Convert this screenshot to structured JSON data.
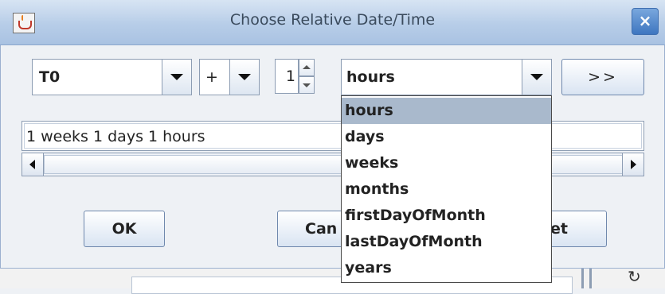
{
  "window": {
    "title": "Choose Relative Date/Time",
    "close_glyph": "×"
  },
  "reference_combo": {
    "value": "T0"
  },
  "operator_combo": {
    "value": "+"
  },
  "amount_spinner": {
    "value": "1"
  },
  "unit_combo": {
    "value": "hours",
    "options": [
      "hours",
      "days",
      "weeks",
      "months",
      "firstDayOfMonth",
      "lastDayOfMonth",
      "years"
    ],
    "highlighted_index": 0
  },
  "append_button": {
    "label": ">>"
  },
  "expression_field": {
    "value": "1 weeks 1 days 1 hours"
  },
  "buttons": {
    "ok_label": "OK",
    "cancel_label": "Can",
    "reset_label": "et"
  },
  "background": {
    "refresh_glyph": "↻"
  },
  "icons": {
    "app": "java-icon",
    "close": "close-icon",
    "dropdown": "chevron-down-icon"
  },
  "colors": {
    "titlebar": "#b7cde8",
    "selection": "#a9b9cc",
    "close_button": "#3e76c0"
  }
}
